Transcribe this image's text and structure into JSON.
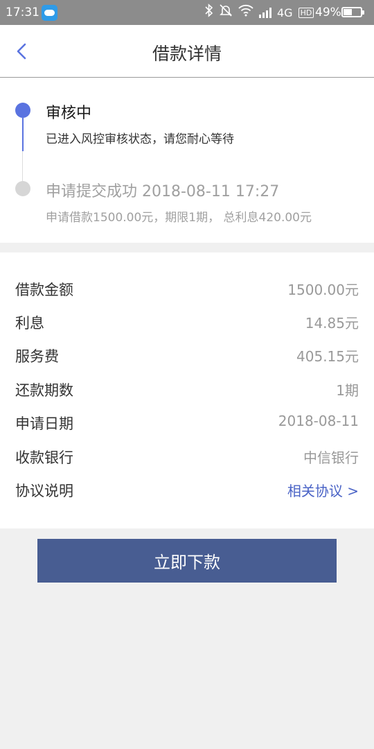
{
  "status_bar": {
    "time": "17:31",
    "network": "4G",
    "hd": "HD",
    "battery_percent": "49%",
    "icons": [
      "weather-icon",
      "bluetooth-icon",
      "mute-bell-icon",
      "wifi-icon",
      "signal-icon",
      "battery-icon"
    ]
  },
  "header": {
    "title": "借款详情",
    "back_icon": "chevron-left-icon",
    "accent_color": "#5a73e0"
  },
  "progress": {
    "steps": [
      {
        "title": "审核中",
        "description": "已进入风控审核状态，请您耐心等待",
        "state": "active"
      },
      {
        "title": "申请提交成功 2018-08-11 17:27",
        "description": "申请借款1500.00元，期限1期， 总利息420.00元",
        "state": "done"
      }
    ]
  },
  "details": {
    "rows": [
      {
        "label": "借款金额",
        "value": "1500.00元"
      },
      {
        "label": "利息",
        "value": "14.85元"
      },
      {
        "label": "服务费",
        "value": "405.15元"
      },
      {
        "label": "还款期数",
        "value": "1期"
      },
      {
        "label": "申请日期",
        "value": "2018-08-11"
      },
      {
        "label": "收款银行",
        "value": "中信银行"
      },
      {
        "label": "协议说明",
        "value": "相关协议 >"
      }
    ]
  },
  "actions": {
    "submit_label": "立即下款",
    "submit_color": "#485d92"
  }
}
